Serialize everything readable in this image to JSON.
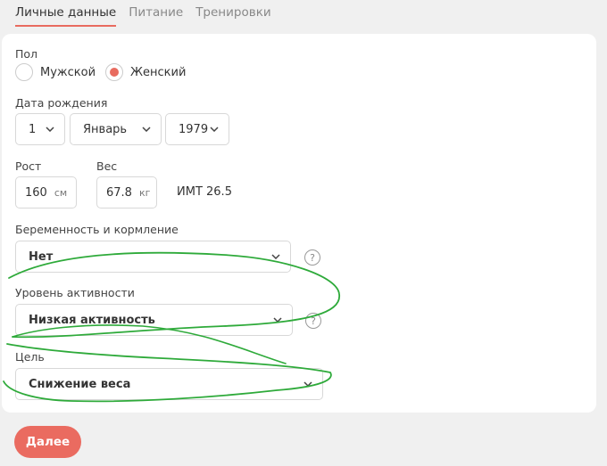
{
  "tabs": [
    "Личные данные",
    "Питание",
    "Тренировки"
  ],
  "gender": {
    "label": "Пол",
    "options": [
      "Мужской",
      "Женский"
    ],
    "selected": "Женский"
  },
  "birth": {
    "label": "Дата рождения",
    "day": "1",
    "month": "Январь",
    "year": "1979"
  },
  "height": {
    "label": "Рост",
    "value": "160",
    "unit": "см"
  },
  "weight": {
    "label": "Вес",
    "value": "67.8",
    "unit": "кг"
  },
  "bmi": "ИМТ 26.5",
  "pregnancy": {
    "label": "Беременность и кормление",
    "value": "Нет"
  },
  "activity": {
    "label": "Уровень активности",
    "value": "Низкая активность"
  },
  "goal": {
    "label": "Цель",
    "value": "Снижение веса"
  },
  "submit_label": "Далее",
  "help_symbol": "?",
  "colors": {
    "accent": "#e86b5f",
    "scribble": "#2eaa3a"
  }
}
